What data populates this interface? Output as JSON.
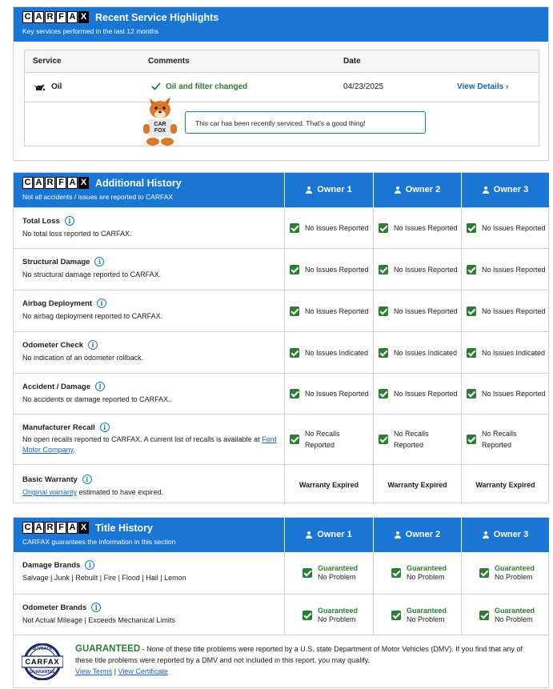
{
  "service": {
    "logo_letters": [
      "C",
      "A",
      "R",
      "F",
      "A",
      "X"
    ],
    "title": "Recent Service Highlights",
    "subtitle": "Key services performed in the last 12 months",
    "columns": [
      "Service",
      "Comments",
      "Date"
    ],
    "row": {
      "service": "Oil",
      "comment": "Oil and filter changed",
      "date": "04/23/2025",
      "details": "View Details"
    },
    "fox_shirt": "CAR FOX",
    "bubble": "This car has been recently serviced. That's a good thing!"
  },
  "additional": {
    "title": "Additional History",
    "subtitle": "Not all accidents / issues are reported to CARFAX",
    "owners": [
      "Owner 1",
      "Owner 2",
      "Owner 3"
    ],
    "rows": [
      {
        "label": "Total Loss",
        "desc": "No total loss reported to CARFAX.",
        "value": "No Issues Reported"
      },
      {
        "label": "Structural Damage",
        "desc": "No structural damage reported to CARFAX.",
        "value": "No Issues Reported"
      },
      {
        "label": "Airbag Deployment",
        "desc": "No airbag deployment reported to CARFAX.",
        "value": "No Issues Reported"
      },
      {
        "label": "Odometer Check",
        "desc": "No indication of an odometer rollback.",
        "value": "No Issues Indicated"
      },
      {
        "label": "Accident / Damage",
        "desc": "No accidents or damage reported to CARFAX.",
        "value": "No Issues Reported"
      }
    ],
    "recall": {
      "label": "Manufacturer Recall",
      "desc": "No open recalls reported to CARFAX. A current list of recalls is available at",
      "link": "Ford Motor Company",
      "link_suffix": ".",
      "value_line1": "No Recalls",
      "value_line2": "Reported"
    },
    "warranty": {
      "label": "Basic Warranty",
      "link": "Original warranty",
      "desc": " estimated to have expired.",
      "value": "Warranty Expired"
    }
  },
  "title_history": {
    "title": "Title History",
    "subtitle": "CARFAX guarantees the information in this section",
    "owners": [
      "Owner 1",
      "Owner 2",
      "Owner 3"
    ],
    "rows": [
      {
        "label": "Damage Brands",
        "desc": "Salvage | Junk | Rebuilt | Fire | Flood | Hail | Lemon"
      },
      {
        "label": "Odometer Brands",
        "desc": "Not Actual Mileage | Exceeds Mechanical Limits"
      }
    ],
    "status_top": "Guaranteed",
    "status_bottom": "No Problem",
    "seal_top": "BUYBACK",
    "seal_bottom": "GUARANTEE",
    "guarantee_heading": "GUARANTEED",
    "guarantee_text": " - None of these title problems were reported by a U.S. state Department of Motor Vehicles (DMV). If you find that any of these title problems were reported by a DMV and not included in this report, you may qualify.",
    "view_terms": "View Terms",
    "separator": " | ",
    "view_certificate": "View Certificate"
  },
  "colors": {
    "brand_blue": "#1976d2",
    "check_green": "#2e7d32",
    "link_blue": "#1565c0"
  }
}
